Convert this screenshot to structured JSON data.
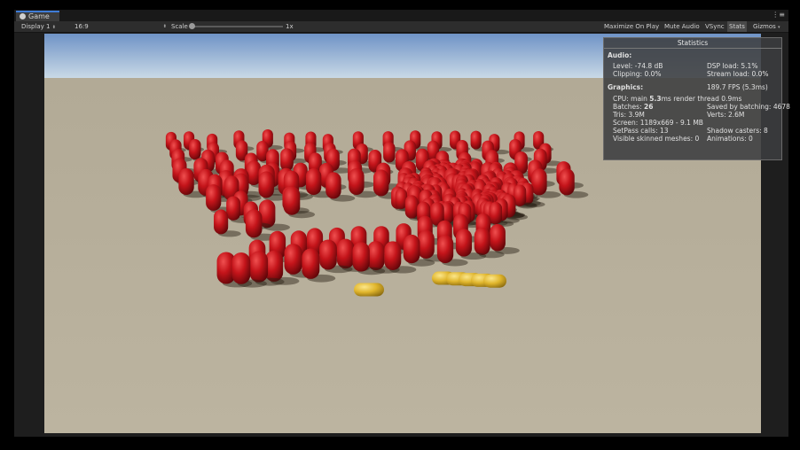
{
  "window": {
    "tab_title": "Game"
  },
  "toolbar": {
    "display": "Display 1",
    "aspect": "16:9",
    "scale_label": "Scale",
    "scale_value": "1x",
    "maximize_on_play": "Maximize On Play",
    "mute_audio": "Mute Audio",
    "vsync": "VSync",
    "stats": "Stats",
    "gizmos": "Gizmos"
  },
  "stats": {
    "title": "Statistics",
    "audio_heading": "Audio:",
    "level_label": "Level:",
    "level_value": "-74.8 dB",
    "clipping_label": "Clipping:",
    "clipping_value": "0.0%",
    "dsp_label": "DSP load:",
    "dsp_value": "5.1%",
    "stream_label": "Stream load:",
    "stream_value": "0.0%",
    "graphics_heading": "Graphics:",
    "fps": "189.7 FPS (5.3ms)",
    "cpu_label": "CPU: main",
    "cpu_main": "5.3",
    "cpu_rest": "ms  render thread 0.9ms",
    "batches_label": "Batches:",
    "batches_value": "26",
    "saved_batching": "Saved by batching: 4678",
    "tris": "Tris: 3.9M",
    "verts": "Verts: 2.6M",
    "screen": "Screen: 1189x669 - 9.1 MB",
    "setpass": "SetPass calls: 13",
    "shadow_casters": "Shadow casters: 8",
    "skinned": "Visible skinned meshes: 0",
    "animations": "Animations: 0"
  },
  "scene": {
    "sky_top": "#6f93c6",
    "sky_horizon": "#c9d9e6",
    "ground": "#b8b09c",
    "capsule_color": "#c4141a",
    "highlight_color": "#e8c63a"
  }
}
